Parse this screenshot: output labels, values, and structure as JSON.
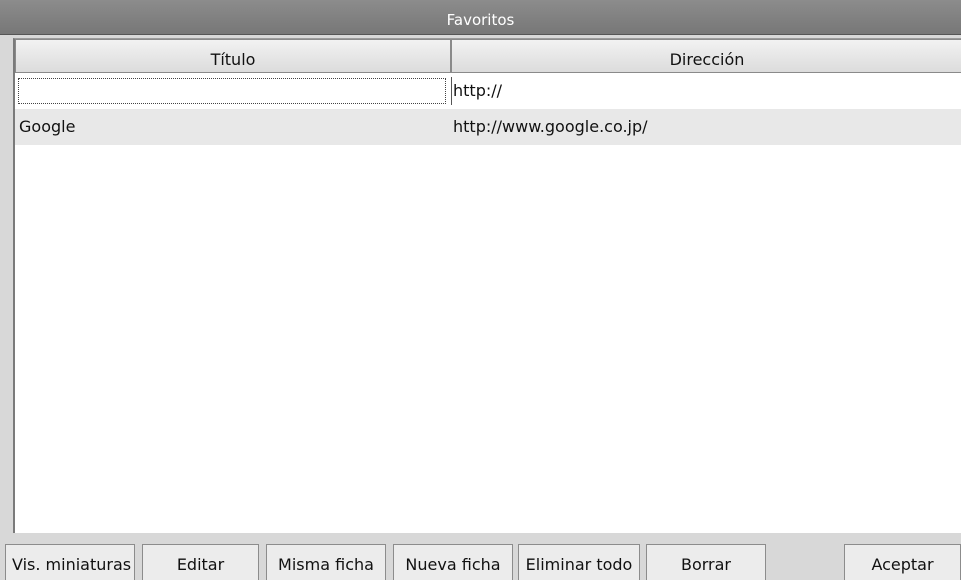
{
  "window": {
    "title": "Favoritos"
  },
  "table": {
    "columns": [
      "Título",
      "Dirección"
    ],
    "new_row": {
      "title": "",
      "address": "http://"
    },
    "rows": [
      {
        "title": "Google",
        "address": "http://www.google.co.jp/"
      }
    ]
  },
  "buttons": {
    "thumbnails": "Vis. miniaturas",
    "edit": "Editar",
    "same_tab": "Misma ficha",
    "new_tab": "Nueva ficha",
    "delete_all": "Eliminar todo",
    "delete": "Borrar",
    "accept": "Aceptar"
  },
  "colors": {
    "titlebar": "#808080",
    "selected_row": "#e8e8e8"
  }
}
